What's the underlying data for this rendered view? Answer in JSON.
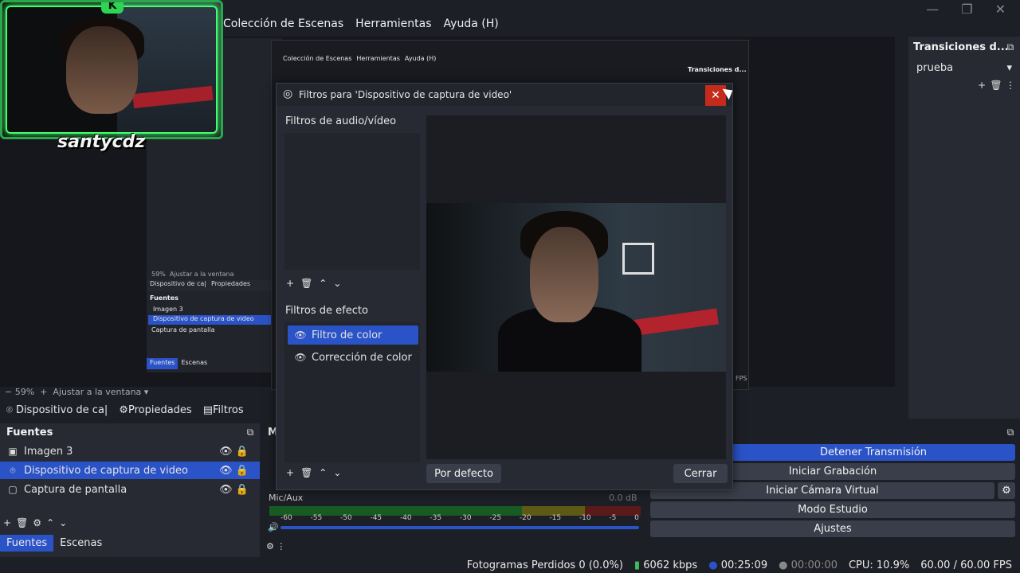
{
  "window": {
    "menu": [
      "Colección de Escenas",
      "Herramientas",
      "Ayuda (H)"
    ],
    "controls": [
      "minimize-icon",
      "maximize-icon",
      "close-icon"
    ]
  },
  "overlay": {
    "streamer_name": "santycdz",
    "logo_letter": "K"
  },
  "nested_preview": {
    "menu": [
      "Colección de Escenas",
      "Herramientas",
      "Ayuda (H)"
    ],
    "zoom": "59%",
    "fit_label": "Ajustar a la ventana",
    "sources_header": "Fuentes",
    "sources": [
      "Imagen 3",
      "Dispositivo de captura de video",
      "Captura de pantalla"
    ],
    "tabs": [
      "Fuentes",
      "Escenas"
    ],
    "transitions_header": "Transiciones d...",
    "source_short": "Dispositivo de ca|",
    "props_label": "Propiedades",
    "fps": "FPS"
  },
  "main": {
    "zoom": "59%",
    "fit_label": "Ajustar a la ventana",
    "context_source": "Dispositivo de ca|",
    "context_props": "Propiedades",
    "context_filters": "Filtros",
    "sources_header": "Fuentes",
    "sources": [
      {
        "name": "Imagen 3",
        "selected": false
      },
      {
        "name": "Dispositivo de captura de video",
        "selected": true
      },
      {
        "name": "Captura de pantalla",
        "selected": false
      }
    ],
    "bottom_tabs": [
      "Fuentes",
      "Escenas"
    ],
    "mixer_letter": "M",
    "mixer": {
      "label": "Mic/Aux",
      "db": "0.0 dB",
      "scale": [
        "-60",
        "-55",
        "-50",
        "-45",
        "-40",
        "-35",
        "-30",
        "-25",
        "-20",
        "-15",
        "-10",
        "-5",
        "0"
      ]
    }
  },
  "transitions": {
    "header": "Transiciones d...",
    "selected": "prueba"
  },
  "controls_panel": {
    "buttons": [
      "Detener Transmisión",
      "Iniciar Grabación",
      "Iniciar Cámara Virtual",
      "Modo Estudio",
      "Ajustes"
    ]
  },
  "dialog": {
    "title": "Filtros para 'Dispositivo de captura de video'",
    "audio_video_header": "Filtros de audio/vídeo",
    "effects_header": "Filtros de efecto",
    "effects": [
      {
        "name": "Filtro de color",
        "selected": true
      },
      {
        "name": "Corrección de color",
        "selected": false
      }
    ],
    "defaults_button": "Por defecto",
    "close_button": "Cerrar"
  },
  "status": {
    "dropped": "Fotogramas Perdidos 0 (0.0%)",
    "kbps": "6062 kbps",
    "stream_time": "00:25:09",
    "record_time": "00:00:00",
    "cpu": "CPU: 10.9%",
    "fps": "60.00 / 60.00 FPS"
  },
  "colors": {
    "accent": "#2b53c8",
    "neon": "#41ff6a",
    "close_red": "#c42b1c"
  }
}
